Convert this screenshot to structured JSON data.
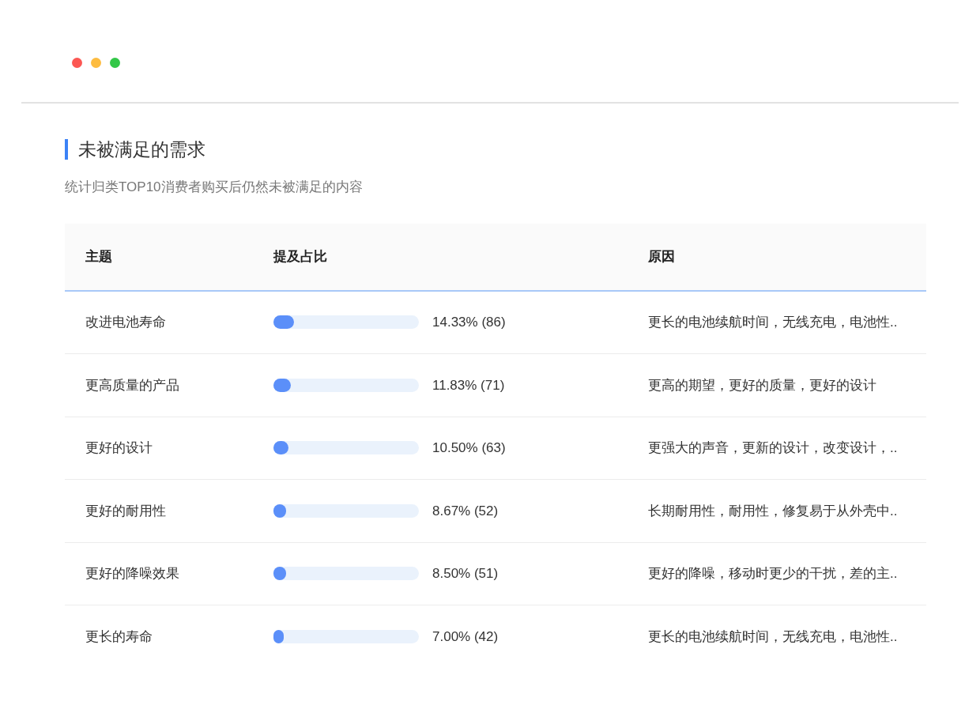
{
  "window": {
    "controls": [
      {
        "color": "#fc5753"
      },
      {
        "color": "#fdbc40"
      },
      {
        "color": "#33c748"
      }
    ]
  },
  "section": {
    "title": "未被满足的需求",
    "subtitle": "统计归类TOP10消费者购买后仍然未被满足的内容"
  },
  "table": {
    "columns": [
      "主题",
      "提及占比",
      "原因"
    ],
    "rows": [
      {
        "theme": "改进电池寿命",
        "level": 0.1433,
        "reading": "14.33% (86)",
        "reason": "更长的电池续航时间，无线充电，电池性.."
      },
      {
        "theme": "更高质量的产品",
        "level": 0.1183,
        "reading": "11.83% (71)",
        "reason": "更高的期望，更好的质量，更好的设计"
      },
      {
        "theme": "更好的设计",
        "level": 0.105,
        "reading": "10.50% (63)",
        "reason": "更强大的声音，更新的设计，改变设计，.."
      },
      {
        "theme": "更好的耐用性",
        "level": 0.0867,
        "reading": "8.67% (52)",
        "reason": "长期耐用性，耐用性，修复易于从外壳中.."
      },
      {
        "theme": "更好的降噪效果",
        "level": 0.085,
        "reading": "8.50% (51)",
        "reason": "更好的降噪，移动时更少的干扰，差的主.."
      },
      {
        "theme": "更长的寿命",
        "level": 0.07,
        "reading": "7.00% (42)",
        "reason": "更长的电池续航时间，无线充电，电池性.."
      }
    ]
  }
}
